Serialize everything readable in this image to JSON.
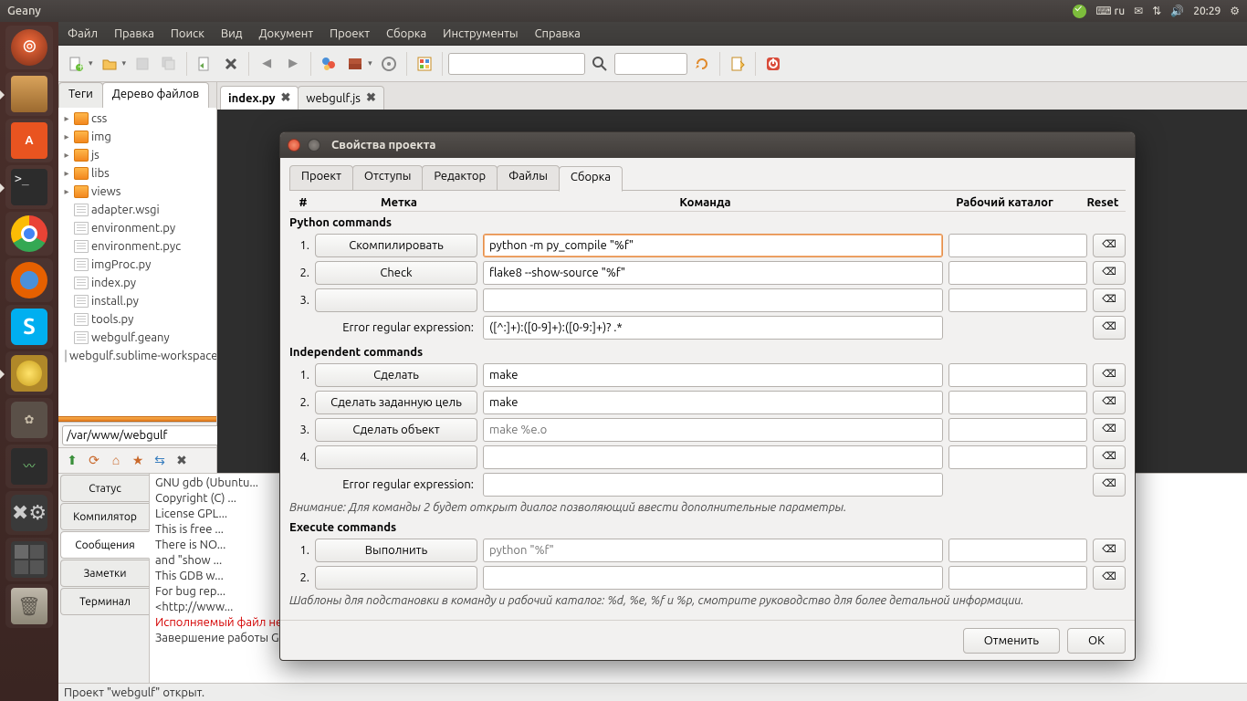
{
  "panel": {
    "app": "Geany",
    "kb": "ru",
    "time": "20:29"
  },
  "menu": [
    "Файл",
    "Правка",
    "Поиск",
    "Вид",
    "Документ",
    "Проект",
    "Сборка",
    "Инструменты",
    "Справка"
  ],
  "side": {
    "tabs": [
      "Теги",
      "Дерево файлов"
    ],
    "folders": [
      "css",
      "img",
      "js",
      "libs",
      "views"
    ],
    "files": [
      "adapter.wsgi",
      "environment.py",
      "environment.pyc",
      "imgProc.py",
      "index.py",
      "install.py",
      "tools.py",
      "webgulf.geany",
      "webgulf.sublime-workspace"
    ],
    "path": "/var/www/webgulf"
  },
  "editor": {
    "tabs": [
      {
        "name": "index.py",
        "active": true
      },
      {
        "name": "webgulf.js",
        "active": false
      }
    ]
  },
  "msgs": {
    "tabs": [
      "Статус",
      "Компилятор",
      "Сообщения",
      "Заметки",
      "Терминал"
    ],
    "lines": [
      "GNU gdb (Ubuntu...",
      "Copyright (C) ...",
      "License GPL...",
      "This is free ...",
      "There is NO...",
      "and \"show ...",
      "This GDB w...",
      "For bug rep...",
      "<http://www...",
      "Исполняемый файл не содержит необходимой отладочной информации.",
      "Завершение работы GDB"
    ]
  },
  "status": "Проект \"webgulf\" открыт.",
  "dialog": {
    "title": "Свойства проекта",
    "tabs": [
      "Проект",
      "Отступы",
      "Редактор",
      "Файлы",
      "Сборка"
    ],
    "head": {
      "n": "#",
      "label": "Метка",
      "cmd": "Команда",
      "wd": "Рабочий каталог",
      "reset": "Reset"
    },
    "s1": {
      "title": "Python commands",
      "r1": {
        "n": "1.",
        "label": "Скомпилировать",
        "cmd": "python -m py_compile \"%f\""
      },
      "r2": {
        "n": "2.",
        "label": "Check",
        "cmd": "flake8 --show-source \"%f\""
      },
      "r3": {
        "n": "3."
      },
      "err": {
        "label": "Error regular expression:",
        "cmd": "([^:]+):([0-9]+):([0-9:]+)? .*"
      }
    },
    "s2": {
      "title": "Independent commands",
      "r1": {
        "n": "1.",
        "label": "Сделать",
        "cmd": "make"
      },
      "r2": {
        "n": "2.",
        "label": "Сделать заданную цель",
        "cmd": "make"
      },
      "r3": {
        "n": "3.",
        "label": "Сделать объект",
        "ph": "make %e.o"
      },
      "r4": {
        "n": "4."
      },
      "err": {
        "label": "Error regular expression:"
      },
      "note": "Внимание: Для команды 2 будет открыт диалог позволяющий ввести дополнительные параметры."
    },
    "s3": {
      "title": "Execute commands",
      "r1": {
        "n": "1.",
        "label": "Выполнить",
        "ph": "python \"%f\""
      },
      "r2": {
        "n": "2."
      },
      "note": "Шаблоны для подстановки в команду и рабочий каталог: %d, %e, %f и %p, смотрите руководство для более детальной информации."
    },
    "cancel": "Отменить",
    "ok": "OK",
    "reset_glyph": "⌫"
  }
}
